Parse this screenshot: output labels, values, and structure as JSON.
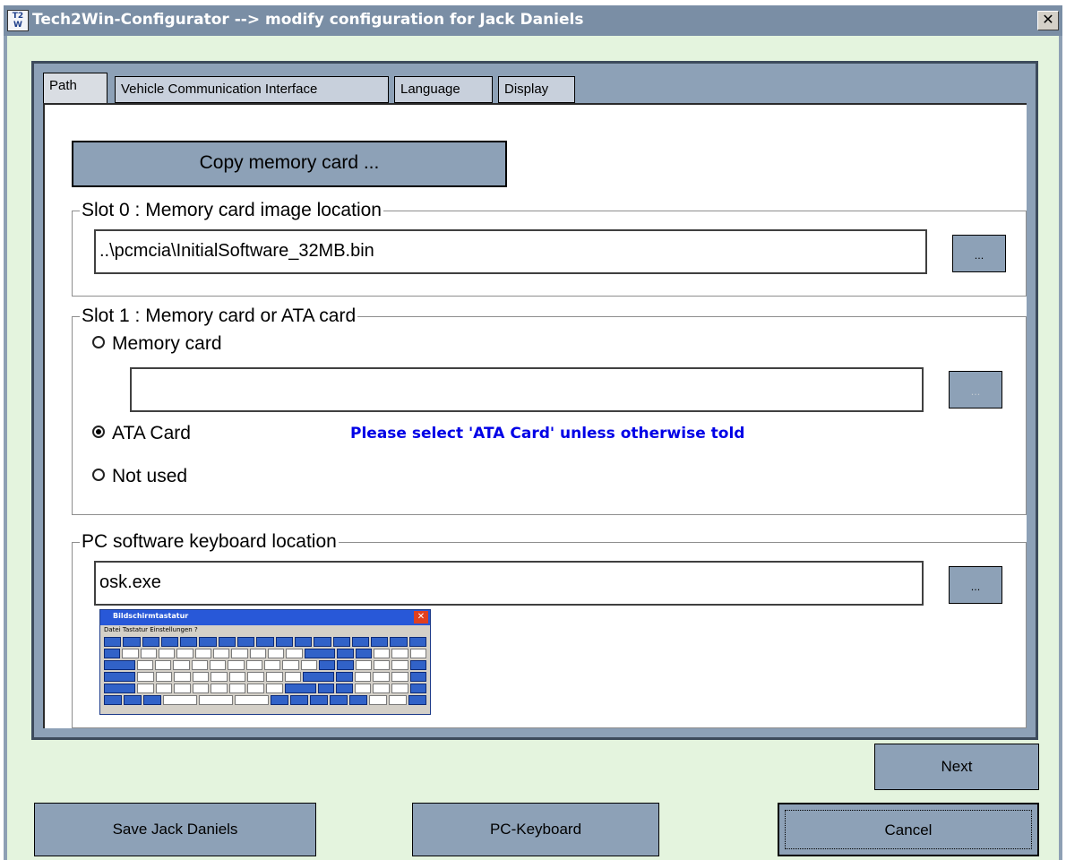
{
  "window": {
    "title": "Tech2Win-Configurator --> modify configuration for Jack Daniels",
    "icon_text": "Tech2\nWin",
    "close_label": "✕"
  },
  "tabs": [
    {
      "label": "Path",
      "active": true
    },
    {
      "label": "Vehicle Communication Interface",
      "active": false
    },
    {
      "label": "Language",
      "active": false
    },
    {
      "label": "Display",
      "active": false
    }
  ],
  "path_tab": {
    "copy_button": "Copy memory card ...",
    "slot0": {
      "legend": "Slot 0 : Memory card image location",
      "value": "..\\pcmcia\\InitialSoftware_32MB.bin",
      "browse": "..."
    },
    "slot1": {
      "legend": "Slot 1 : Memory card or ATA card",
      "options": [
        {
          "label": "Memory card",
          "checked": false
        },
        {
          "label": "ATA Card",
          "checked": true
        },
        {
          "label": "Not used",
          "checked": false
        }
      ],
      "memory_value": "",
      "browse": "...",
      "hint": "Please select 'ATA Card' unless otherwise told"
    },
    "keyboard": {
      "legend": "PC software keyboard location",
      "value": "osk.exe",
      "browse": "...",
      "thumb_title": "Bildschirmtastatur",
      "thumb_menu": "Datei   Tastatur   Einstellungen   ?"
    }
  },
  "buttons": {
    "next": "Next",
    "save": "Save Jack Daniels",
    "pc_keyboard": "PC-Keyboard",
    "cancel": "Cancel"
  }
}
